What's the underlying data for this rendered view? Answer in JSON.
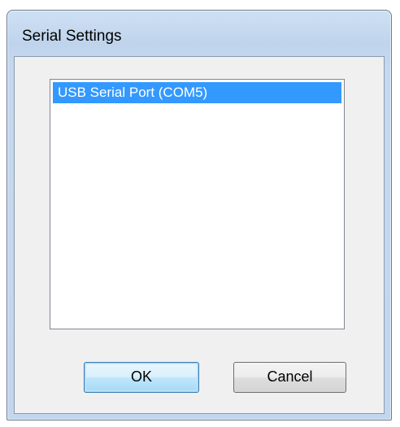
{
  "dialog": {
    "title": "Serial Settings"
  },
  "port_list": {
    "items": [
      {
        "label": "USB Serial Port (COM5)",
        "selected": true
      }
    ],
    "selection_color": "#3399ff"
  },
  "buttons": {
    "ok_label": "OK",
    "cancel_label": "Cancel"
  }
}
